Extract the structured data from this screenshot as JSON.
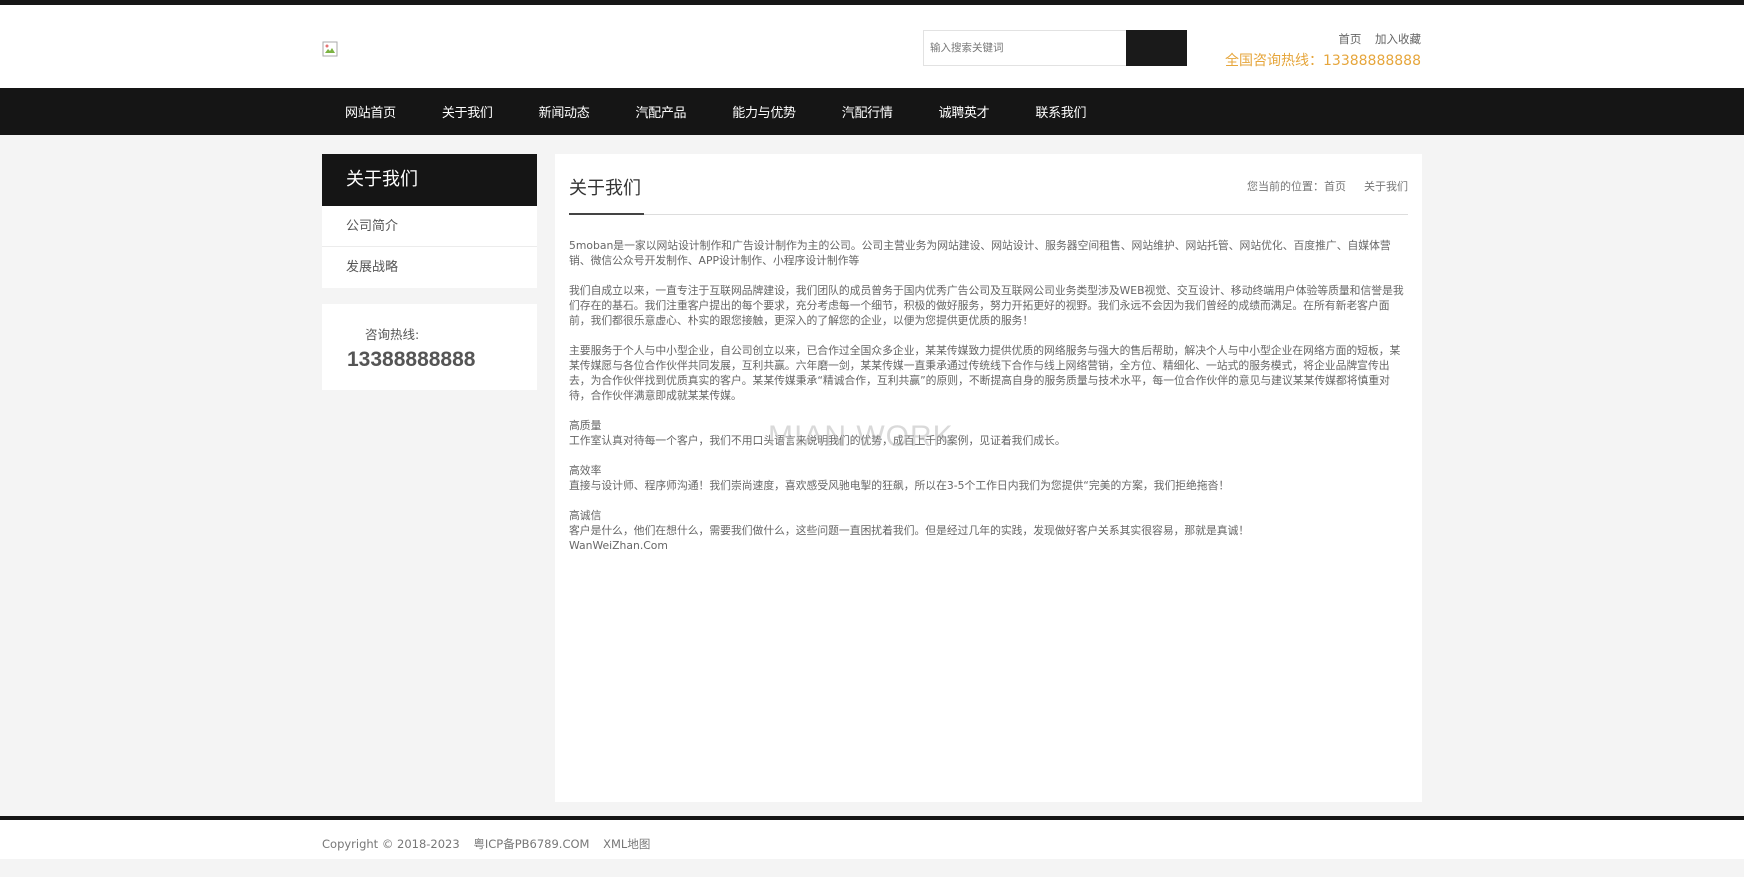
{
  "header": {
    "search_placeholder": "输入搜索关键词",
    "top_links": [
      "首页",
      "加入收藏"
    ],
    "hotline": "全国咨询热线：13388888888"
  },
  "nav": {
    "items": [
      "网站首页",
      "关于我们",
      "新闻动态",
      "汽配产品",
      "能力与优势",
      "汽配行情",
      "诚聘英才",
      "联系我们"
    ]
  },
  "sidebar": {
    "title": "关于我们",
    "items": [
      "公司简介",
      "发展战略"
    ],
    "contact_label": "咨询热线:",
    "contact_number": "13388888888"
  },
  "main": {
    "title": "关于我们",
    "breadcrumb": {
      "prefix": "您当前的位置：",
      "home": "首页",
      "current": "关于我们"
    },
    "paragraphs": [
      "5moban是一家以网站设计制作和广告设计制作为主的公司。公司主营业务为网站建设、网站设计、服务器空间租售、网站维护、网站托管、网站优化、百度推广、自媒体营销、微信公众号开发制作、APP设计制作、小程序设计制作等",
      "我们自成立以来，一直专注于互联网品牌建设，我们团队的成员曾务于国内优秀广告公司及互联网公司业务类型涉及WEB视觉、交互设计、移动终端用户体验等质量和信誉是我们存在的基石。我们注重客户提出的每个要求，充分考虑每一个细节，积极的做好服务，努力开拓更好的视野。我们永远不会因为我们曾经的成绩而满足。在所有新老客户面前，我们都很乐意虚心、朴实的跟您接触，更深入的了解您的企业，以便为您提供更优质的服务！",
      "主要服务于个人与中小型企业，自公司创立以来，已合作过全国众多企业，某某传媒致力提供优质的网络服务与强大的售后帮助，解决个人与中小型企业在网络方面的短板，某某传媒愿与各位合作伙伴共同发展，互利共赢。六年磨一剑，某某传媒一直秉承通过传统线下合作与线上网络营销，全方位、精细化、一站式的服务模式，将企业品牌宣传出去，为合作伙伴找到优质真实的客户。某某传媒秉承“精诚合作，互利共赢”的原则，不断提高自身的服务质量与技术水平，每一位合作伙伴的意见与建议某某传媒都将慎重对待，合作伙伴满意即成就某某传媒。"
    ],
    "features": [
      {
        "heading": "高质量",
        "text": "工作室认真对待每一个客户，我们不用口头语言来说明我们的优势，成百上千的案例，见证着我们成长。"
      },
      {
        "heading": "高效率",
        "text": "直接与设计师、程序师沟通！我们崇尚速度，喜欢感受风驰电掣的狂飙，所以在3-5个工作日内我们为您提供“完美的方案，我们拒绝拖沓！"
      },
      {
        "heading": "高诚信",
        "text": "客户是什么，他们在想什么，需要我们做什么，这些问题一直困扰着我们。但是经过几年的实践，发现做好客户关系其实很容易，那就是真诚！"
      }
    ],
    "signature": "WanWeiZhan.Com"
  },
  "watermark": "MIAN WORK",
  "footer": {
    "copyright": "Copyright © 2018-2023",
    "icp": "粤ICP备PB6789.COM",
    "sitemap": "XML地图"
  },
  "colors": {
    "dark": "#151515",
    "accent": "#e6a63c",
    "page_bg": "#f4f4f4"
  }
}
